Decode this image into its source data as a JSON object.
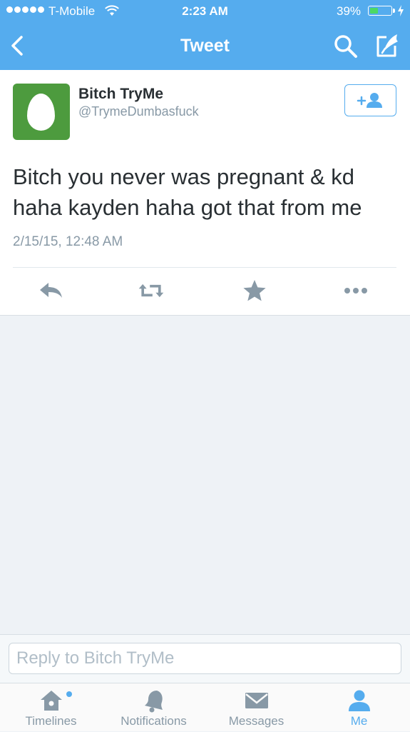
{
  "status_bar": {
    "carrier": "T-Mobile",
    "time": "2:23 AM",
    "battery_pct": "39%",
    "battery_level": 0.39
  },
  "nav": {
    "title": "Tweet",
    "back_icon": "chevron-left-icon",
    "search_icon": "search-icon",
    "compose_icon": "compose-icon"
  },
  "tweet": {
    "author_name": "Bitch TryMe",
    "author_handle": "@TrymeDumbasfuck",
    "text": "Bitch you never was pregnant & kd haha kayden haha got that from me",
    "timestamp": "2/15/15, 12:48 AM",
    "actions": [
      "reply-icon",
      "retweet-icon",
      "favorite-icon",
      "more-icon"
    ]
  },
  "reply": {
    "placeholder": "Reply to Bitch TryMe"
  },
  "tabbar": {
    "items": [
      {
        "label": "Timelines",
        "icon": "home-icon",
        "active": false
      },
      {
        "label": "Notifications",
        "icon": "bell-icon",
        "active": false
      },
      {
        "label": "Messages",
        "icon": "envelope-icon",
        "active": false
      },
      {
        "label": "Me",
        "icon": "person-icon",
        "active": true
      }
    ]
  },
  "colors": {
    "brand": "#55acee",
    "avatar_bg": "#4d9b3e",
    "muted": "#8899a6",
    "text": "#292f33",
    "battery": "#4cd964"
  }
}
